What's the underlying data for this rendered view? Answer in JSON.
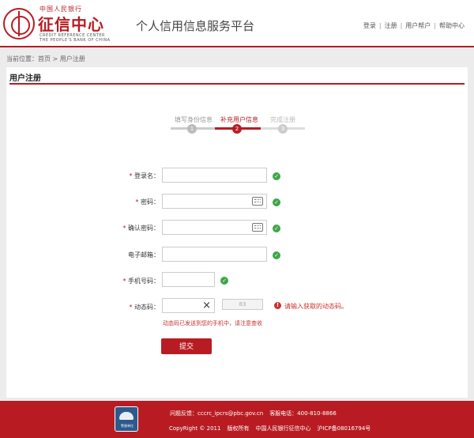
{
  "header": {
    "logo_top": "中国人民银行",
    "logo_main": "征信中心",
    "logo_en1": "CREDIT REFERENCE CENTER",
    "logo_en2": "THE PEOPLE'S BANK OF CHINA",
    "platform_title": "个人信用信息服务平台",
    "nav": [
      "登录",
      "注册",
      "用户帮户",
      "帮助中心"
    ]
  },
  "breadcrumb": "当前位置：首页 > 用户注册",
  "panel_title": "用户注册",
  "steps": [
    {
      "label": "填写身份信息",
      "number": "1",
      "state": "done"
    },
    {
      "label": "补充用户信息",
      "number": "2",
      "state": "active"
    },
    {
      "label": "完成注册",
      "number": "3",
      "state": "pending"
    }
  ],
  "form": {
    "required_mark": "*",
    "login_label": "登录名：",
    "password_label": "密码：",
    "confirm_label": "确认密码：",
    "email_label": "电子邮箱：",
    "phone_label": "手机号码：",
    "code_label": "动态码：",
    "clear_icon": "×",
    "code_button": "83",
    "warn_text": "请输入获取的动态码。",
    "sent_text": "动态码已发送到您的手机中，请注意查收",
    "submit": "提交",
    "ok_mark": "✓",
    "warn_mark": "!"
  },
  "footer": {
    "feedback": "问题反馈：cccrc_ipcrs@pbc.gov.cn",
    "hotline": "客服电话：400-810-8866",
    "copyright": "CopyRight © 2011",
    "rights": "版权所有",
    "owner": "中国人民银行征信中心",
    "icp": "沪ICP备08016794号",
    "badge": "警盾单位"
  },
  "colors": {
    "brand_red": "#b81c22",
    "ok_green": "#3fa648",
    "warn_red": "#c9302c"
  }
}
